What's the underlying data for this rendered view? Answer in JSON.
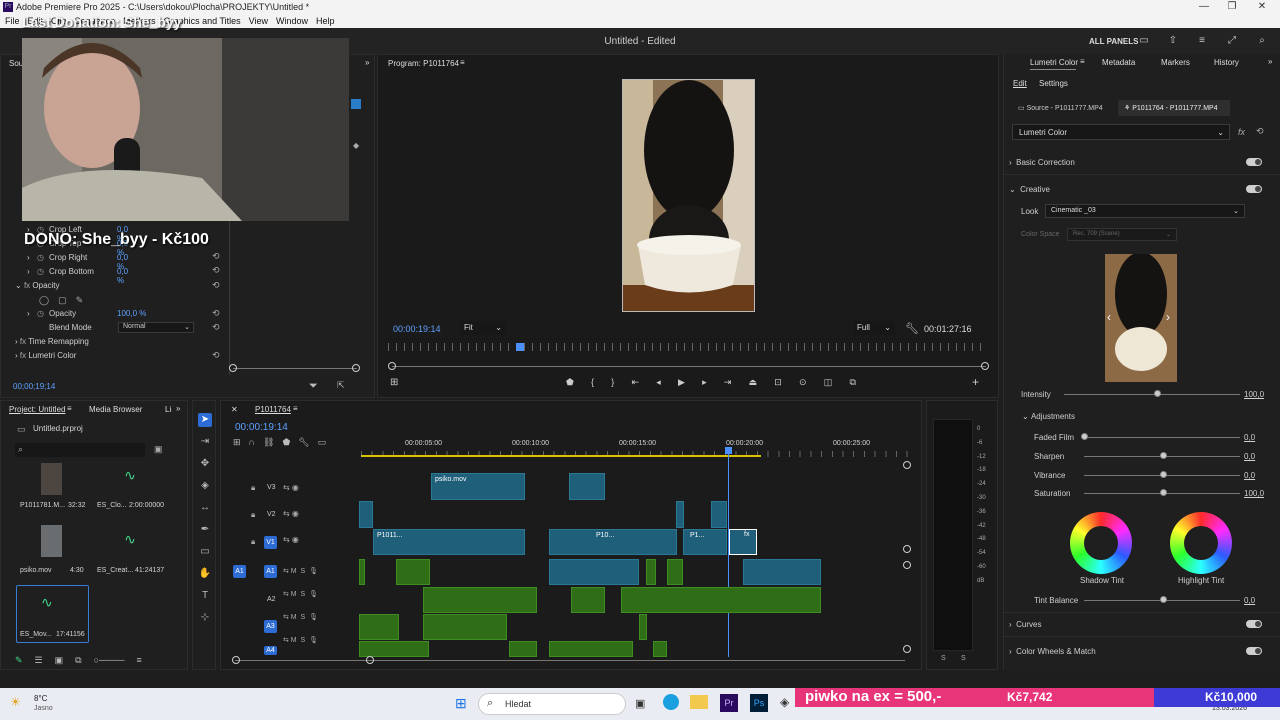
{
  "window": {
    "title": "Adobe Premiere Pro 2025 - C:\\Users\\dokou\\Plocha\\PROJEKTY\\Untitled *",
    "menu": [
      "File",
      "Edit",
      "Clip",
      "Sequence",
      "Markers",
      "Graphics and Titles",
      "View",
      "Window",
      "Help"
    ]
  },
  "header": {
    "center_title": "Untitled - Edited",
    "all_panels": "ALL PANELS"
  },
  "overlay": {
    "top_text": "Last Donation: She_byy",
    "dono_text": "DONO: She_byy - Kč100"
  },
  "effect_controls": {
    "tab": "Sour",
    "rows": [
      {
        "label": "Crop Left",
        "value": "0,0 %"
      },
      {
        "label": "Crop Top",
        "value": "0,0 %"
      },
      {
        "label": "Crop Right",
        "value": "0,0 %"
      },
      {
        "label": "Crop Bottom",
        "value": "0,0 %"
      }
    ],
    "opacity_section": "Opacity",
    "opacity_label": "Opacity",
    "opacity_value": "100,0 %",
    "blend_label": "Blend Mode",
    "blend_value": "Normal",
    "time_remap": "Time Remapping",
    "lumetri": "Lumetri Color",
    "timecode": "00;00;19;14"
  },
  "program": {
    "tab": "Program: P1011764",
    "timecode_left": "00:00:19:14",
    "fit": "Fit",
    "quality": "Full",
    "timecode_right": "00:01:27:16"
  },
  "lumetri": {
    "tabs": [
      "Lumetri Color",
      "Metadata",
      "Markers",
      "History"
    ],
    "subtabs": [
      "Edit",
      "Settings"
    ],
    "source_a": "Source - P1011777.MP4",
    "source_b": "P1011764 - P1011777.MP4",
    "effect": "Lumetri Color",
    "basic_correction": "Basic Correction",
    "creative": "Creative",
    "look_label": "Look",
    "look_value": "Cinematic _03",
    "color_space_label": "Color Space",
    "color_space_value": "Rec. 709 (Scene)",
    "intensity_label": "Intensity",
    "intensity_value": "100,0",
    "adjustments": "Adjustments",
    "sliders": [
      {
        "label": "Faded Film",
        "value": "0,0"
      },
      {
        "label": "Sharpen",
        "value": "0,0"
      },
      {
        "label": "Vibrance",
        "value": "0,0"
      },
      {
        "label": "Saturation",
        "value": "100,0"
      }
    ],
    "shadow_tint": "Shadow Tint",
    "highlight_tint": "Highlight Tint",
    "tint_balance_label": "Tint Balance",
    "tint_balance_value": "0,0",
    "curves": "Curves",
    "color_wheels": "Color Wheels & Match"
  },
  "project": {
    "tabs": [
      "Project: Untitled",
      "Media Browser",
      "Li"
    ],
    "file": "Untitled.prproj",
    "items": [
      {
        "name": "P1011781.M...",
        "duration": "32:32"
      },
      {
        "name": "ES_Clo...",
        "duration": "2:00:00000"
      },
      {
        "name": "psiko.mov",
        "duration": "4:30"
      },
      {
        "name": "ES_Creat...",
        "duration": "41:24137"
      },
      {
        "name": "ES_Mov...",
        "duration": "17:41156"
      }
    ]
  },
  "timeline": {
    "tab": "P1011764",
    "timecode": "00:00:19:14",
    "ruler": [
      "00:00:05:00",
      "00:00:10:00",
      "00:00:15:00",
      "00:00:20:00",
      "00:00:25:00"
    ],
    "video_tracks": [
      "V3",
      "V2",
      "V1"
    ],
    "audio_tracks": [
      "A1",
      "A2",
      "A3",
      "A4"
    ],
    "clip_labels": [
      "psiko.mov",
      "P1011...",
      "P10...",
      "P1...",
      "fx"
    ]
  },
  "meter": {
    "scale": [
      "0",
      "-6",
      "-12",
      "-18",
      "-24",
      "-30",
      "-36",
      "-42",
      "-48",
      "-54",
      "-60",
      "dB"
    ],
    "footer": [
      "S",
      "S"
    ]
  },
  "taskbar": {
    "weather_temp": "8°C",
    "weather_desc": "Jasno",
    "search": "Hledat",
    "date": "13.03.2026"
  },
  "donation_bar": {
    "label": "piwko na ex = 500,-",
    "current": "Kč7,742",
    "goal": "Kč10,000",
    "progress": 0.7742,
    "colors": {
      "fill": "#e8357a",
      "rest": "#3d3ad6"
    }
  }
}
